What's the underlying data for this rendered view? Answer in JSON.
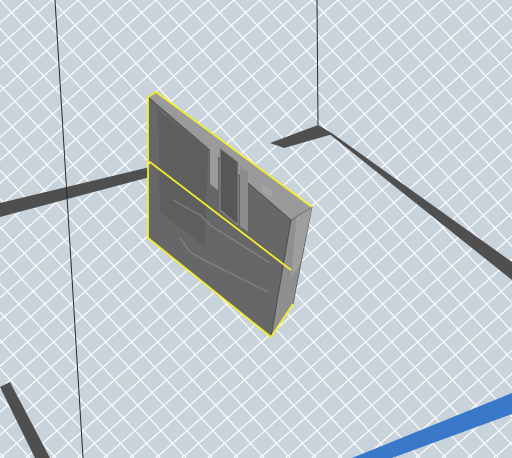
{
  "app": {
    "view": "3d-build-plate-viewport"
  },
  "scene": {
    "background_color": "#c9d3dc",
    "grid_line_color": "#ffffff",
    "plate_border_color": "#4d4d4d",
    "axis_line_color": "#1f1f1f",
    "accent_axis_color": "#3a78c9",
    "selected_object": {
      "name": "cartridge-model",
      "state": "selected",
      "outline_color": "#f2ee2b",
      "body_color": "#6b6b6b"
    }
  },
  "icons": {
    "model": "cartridge-model"
  }
}
